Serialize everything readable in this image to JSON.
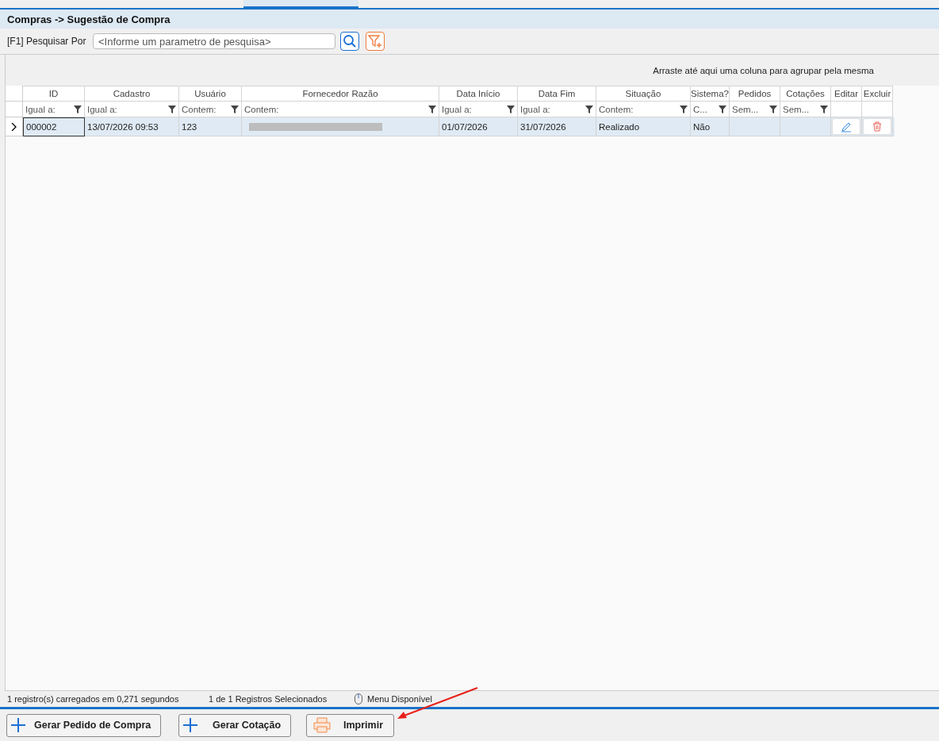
{
  "breadcrumb": "Compras -> Sugestão de Compra",
  "search": {
    "label": "[F1] Pesquisar Por",
    "placeholder": "<Informe um parametro de pesquisa>"
  },
  "group_panel": {
    "hint": "Arraste até aqui uma coluna para agrupar pela mesma"
  },
  "table": {
    "columns": [
      {
        "title": "ID",
        "filter": "Igual a:",
        "kind": "text"
      },
      {
        "title": "Cadastro",
        "filter": "Igual a:",
        "kind": "text"
      },
      {
        "title": "Usuário",
        "filter": "Contem:",
        "kind": "text"
      },
      {
        "title": "Fornecedor Razão",
        "filter": "Contem:",
        "kind": "redacted"
      },
      {
        "title": "Data Início",
        "filter": "Igual a:",
        "kind": "text"
      },
      {
        "title": "Data Fim",
        "filter": "Igual a:",
        "kind": "text"
      },
      {
        "title": "Situação",
        "filter": "Contem:",
        "kind": "text"
      },
      {
        "title": "Sistema?",
        "filter": "C...",
        "kind": "text"
      },
      {
        "title": "Pedidos",
        "filter": "Sem...",
        "kind": "text"
      },
      {
        "title": "Cotações",
        "filter": "Sem...",
        "kind": "text"
      },
      {
        "title": "Editar",
        "kind": "edit"
      },
      {
        "title": "Excluir",
        "kind": "delete"
      }
    ],
    "rows": [
      {
        "selected": true,
        "cells": [
          "000002",
          "13/07/2026 09:53",
          "123",
          "",
          "01/07/2026",
          "31/07/2026",
          "Realizado",
          "Não",
          "",
          "",
          "",
          ""
        ]
      }
    ]
  },
  "status_bar": [
    "1 registro(s) carregados em 0,271 segundos",
    "1 de 1 Registros Selecionados",
    "Menu Disponível"
  ],
  "buttons": [
    {
      "label": "Gerar Pedido de Compra",
      "kind": "add"
    },
    {
      "label": "Gerar Cotação",
      "kind": "add"
    },
    {
      "label": "Imprimir",
      "kind": "print"
    }
  ]
}
